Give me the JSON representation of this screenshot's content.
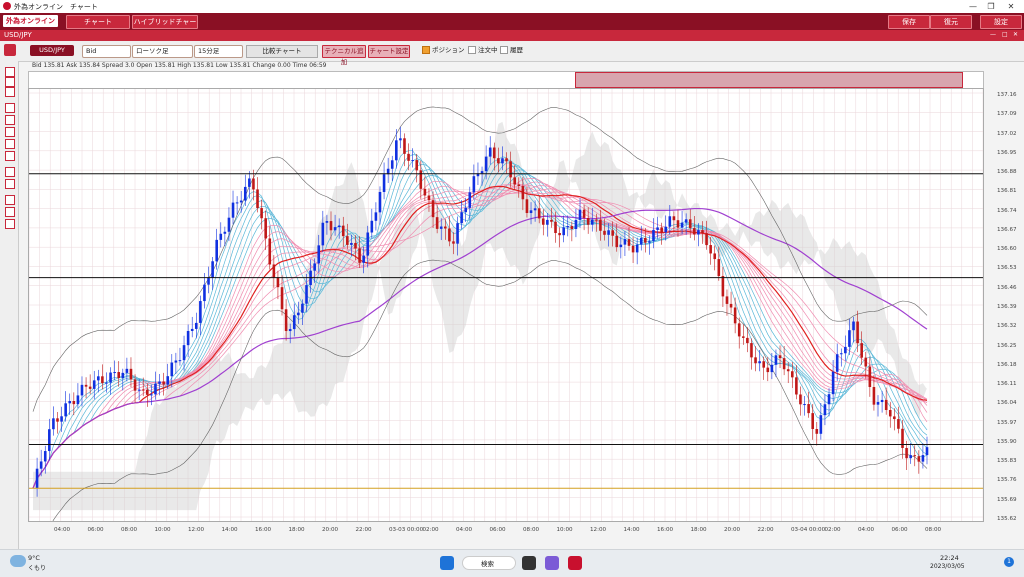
{
  "window": {
    "title": "外為オンライン　チャート",
    "minimize": "—",
    "maximize": "❐",
    "close": "✕"
  },
  "menu": {
    "logo": "外為オンライン",
    "chart": "チャート",
    "hybrid": "ハイブリッドチャート",
    "save": "保存",
    "restore": "復元",
    "settings": "設定"
  },
  "chart_header": {
    "symbol": "USD/JPY",
    "min": "—",
    "max": "□",
    "close": "✕"
  },
  "toolbar": {
    "pair": "USD/JPY",
    "price_type": "Bid",
    "chart_type": "ローソク足",
    "timeframe": "15分足",
    "compare": "比較チャート",
    "add_technical": "テクニカル追加",
    "chart_settings": "チャート設定",
    "position": "ポジション",
    "orders": "注文中",
    "history": "履歴"
  },
  "quote": {
    "text": "Bid   135.81   Ask   135.84   Spread   3.0   Open   135.81   High   135.81   Low   135.81   Change   0.00   Time   06:59"
  },
  "yaxis": [
    "137.16",
    "137.09",
    "137.02",
    "136.95",
    "136.88",
    "136.81",
    "136.74",
    "136.67",
    "136.60",
    "136.53",
    "136.46",
    "136.39",
    "136.32",
    "136.25",
    "136.18",
    "136.11",
    "136.04",
    "135.97",
    "135.90",
    "135.83",
    "135.76",
    "135.69",
    "135.62"
  ],
  "xaxis": [
    "04:00",
    "06:00",
    "08:00",
    "10:00",
    "12:00",
    "14:00",
    "16:00",
    "18:00",
    "20:00",
    "22:00",
    "03-03 00:00",
    "02:00",
    "04:00",
    "06:00",
    "08:00",
    "10:00",
    "12:00",
    "14:00",
    "16:00",
    "18:00",
    "20:00",
    "22:00",
    "03-04 00:00",
    "02:00",
    "04:00",
    "06:00",
    "08:00"
  ],
  "chart_data": {
    "type": "candlestick",
    "ylim": [
      135.6,
      137.18
    ],
    "hlines": [
      136.87,
      136.49,
      135.88
    ],
    "hline_gold": 135.72,
    "closes": [
      135.72,
      135.95,
      136.03,
      136.1,
      136.12,
      136.15,
      136.06,
      136.1,
      136.2,
      136.35,
      136.6,
      136.75,
      136.85,
      136.55,
      136.28,
      136.45,
      136.7,
      136.65,
      136.55,
      136.8,
      137.0,
      136.88,
      136.7,
      136.62,
      136.82,
      136.95,
      136.9,
      136.75,
      136.7,
      136.65,
      136.72,
      136.68,
      136.62,
      136.6,
      136.65,
      136.7,
      136.68,
      136.62,
      136.4,
      136.25,
      136.15,
      136.2,
      136.05,
      135.92,
      136.18,
      136.32,
      136.05,
      136.0,
      135.82,
      135.85
    ],
    "ema_fast_color": "#e02020",
    "ema_slow_color": "#a040d0"
  },
  "taskbar": {
    "weather_temp": "9°C",
    "weather_desc": "くもり",
    "search": "検索",
    "time": "22:24",
    "date": "2023/03/05",
    "notif": "1"
  }
}
